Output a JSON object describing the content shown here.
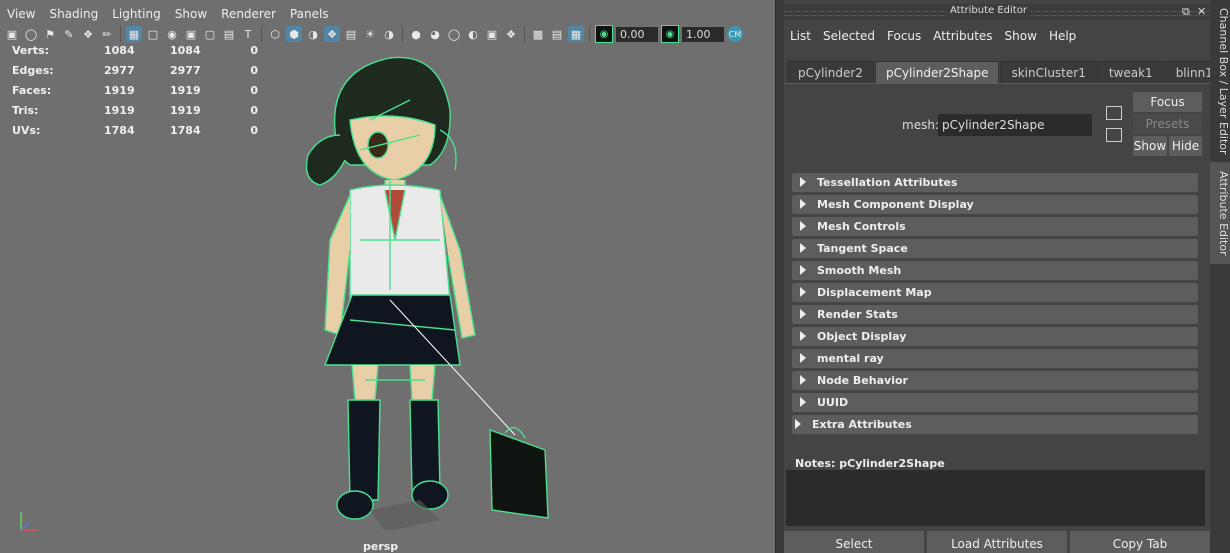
{
  "viewport": {
    "menu": [
      "View",
      "Shading",
      "Lighting",
      "Show",
      "Renderer",
      "Panels"
    ],
    "toolbar": {
      "field1": "0.00",
      "field2": "1.00"
    },
    "hud": [
      {
        "label": "Verts:",
        "v1": "1084",
        "v2": "1084",
        "v3": "0"
      },
      {
        "label": "Edges:",
        "v1": "2977",
        "v2": "2977",
        "v3": "0"
      },
      {
        "label": "Faces:",
        "v1": "1919",
        "v2": "1919",
        "v3": "0"
      },
      {
        "label": "Tris:",
        "v1": "1919",
        "v2": "1919",
        "v3": "0"
      },
      {
        "label": "UVs:",
        "v1": "1784",
        "v2": "1784",
        "v3": "0"
      }
    ],
    "camera": "persp"
  },
  "ae": {
    "title": "Attribute Editor",
    "menu": [
      "List",
      "Selected",
      "Focus",
      "Attributes",
      "Show",
      "Help"
    ],
    "tabs": [
      "pCylinder2",
      "pCylinder2Shape",
      "skinCluster1",
      "tweak1",
      "blinn1"
    ],
    "active_tab": 1,
    "mesh_label": "mesh:",
    "mesh_value": "pCylinder2Shape",
    "focus": "Focus",
    "presets": "Presets",
    "show": "Show",
    "hide": "Hide",
    "sections": [
      "Tessellation Attributes",
      "Mesh Component Display",
      "Mesh Controls",
      "Tangent Space",
      "Smooth Mesh",
      "Displacement Map",
      "Render Stats",
      "Object Display",
      "mental ray",
      "Node Behavior",
      "UUID",
      "Extra Attributes"
    ],
    "notes_label": "Notes:  pCylinder2Shape",
    "bottom": [
      "Select",
      "Load Attributes",
      "Copy Tab"
    ]
  },
  "side_tabs": [
    "Channel Box / Layer Editor",
    "Attribute Editor"
  ],
  "colors": {
    "wire": "#4ae08f",
    "selected_tab": "#5d5d5d",
    "viewport_bg": "#6f6f6f"
  }
}
